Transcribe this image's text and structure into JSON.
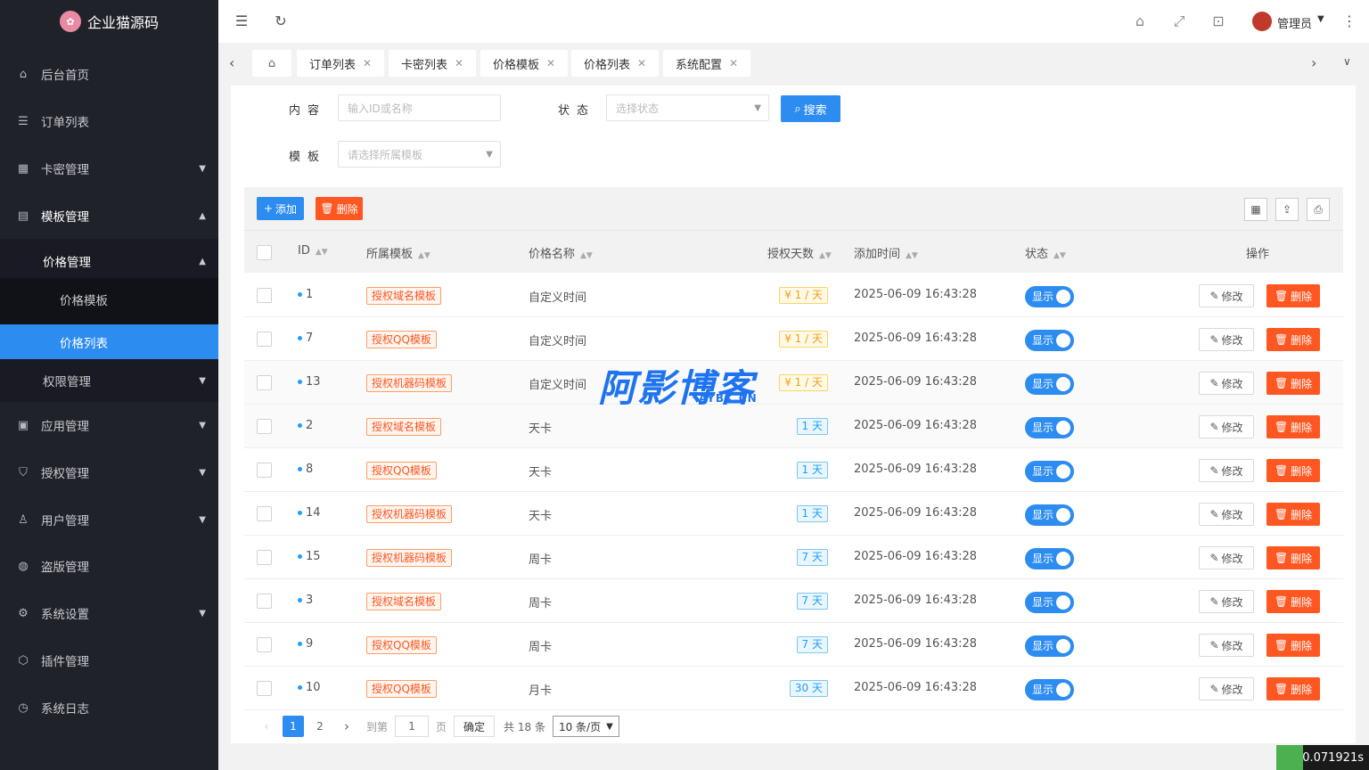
{
  "app": {
    "title": "企业猫源码",
    "logo_text": "企业猫"
  },
  "sidebar": {
    "items": [
      {
        "label": "后台首页",
        "icon": "home-icon"
      },
      {
        "label": "订单列表",
        "icon": "list-icon"
      },
      {
        "label": "卡密管理",
        "icon": "grid-icon"
      },
      {
        "label": "模板管理",
        "icon": "template-icon"
      },
      {
        "label": "价格管理"
      },
      {
        "label": "价格模板"
      },
      {
        "label": "价格列表"
      },
      {
        "label": "权限管理"
      },
      {
        "label": "应用管理",
        "icon": "apps-icon"
      },
      {
        "label": "授权管理",
        "icon": "shield-icon"
      },
      {
        "label": "用户管理",
        "icon": "user-icon"
      },
      {
        "label": "盗版管理",
        "icon": "globe-icon"
      },
      {
        "label": "系统设置",
        "icon": "gear-icon"
      },
      {
        "label": "插件管理",
        "icon": "cube-icon"
      },
      {
        "label": "系统日志",
        "icon": "clock-icon"
      }
    ]
  },
  "topbar": {
    "user": "管理员"
  },
  "tabs": [
    {
      "label": "订单列表"
    },
    {
      "label": "卡密列表"
    },
    {
      "label": "价格模板"
    },
    {
      "label": "价格列表"
    },
    {
      "label": "系统配置"
    }
  ],
  "filters": {
    "content_label": "内容",
    "content_placeholder": "输入ID或名称",
    "status_label": "状态",
    "status_placeholder": "选择状态",
    "search_label": "搜索",
    "template_label": "模板",
    "template_placeholder": "请选择所属模板"
  },
  "toolbar": {
    "add_label": "添加",
    "delete_label": "删除"
  },
  "table": {
    "headers": {
      "id": "ID",
      "template": "所属模板",
      "name": "价格名称",
      "days": "授权天数",
      "time": "添加时间",
      "status": "状态",
      "actions": "操作"
    },
    "edit_label": "修改",
    "delete_label": "删除",
    "rows": [
      {
        "id": "1",
        "template": "授权域名模板",
        "name": "自定义时间",
        "days": "¥ 1 / 天",
        "days_type": "price",
        "time": "2025-06-09 16:43:28",
        "status": "显示"
      },
      {
        "id": "7",
        "template": "授权QQ模板",
        "name": "自定义时间",
        "days": "¥ 1 / 天",
        "days_type": "price",
        "time": "2025-06-09 16:43:28",
        "status": "显示"
      },
      {
        "id": "13",
        "template": "授权机器码模板",
        "name": "自定义时间",
        "days": "¥ 1 / 天",
        "days_type": "price",
        "time": "2025-06-09 16:43:28",
        "status": "显示"
      },
      {
        "id": "2",
        "template": "授权域名模板",
        "name": "天卡",
        "days": "1 天",
        "days_type": "day",
        "time": "2025-06-09 16:43:28",
        "status": "显示"
      },
      {
        "id": "8",
        "template": "授权QQ模板",
        "name": "天卡",
        "days": "1 天",
        "days_type": "day",
        "time": "2025-06-09 16:43:28",
        "status": "显示"
      },
      {
        "id": "14",
        "template": "授权机器码模板",
        "name": "天卡",
        "days": "1 天",
        "days_type": "day",
        "time": "2025-06-09 16:43:28",
        "status": "显示"
      },
      {
        "id": "15",
        "template": "授权机器码模板",
        "name": "周卡",
        "days": "7 天",
        "days_type": "day",
        "time": "2025-06-09 16:43:28",
        "status": "显示"
      },
      {
        "id": "3",
        "template": "授权域名模板",
        "name": "周卡",
        "days": "7 天",
        "days_type": "day",
        "time": "2025-06-09 16:43:28",
        "status": "显示"
      },
      {
        "id": "9",
        "template": "授权QQ模板",
        "name": "周卡",
        "days": "7 天",
        "days_type": "day",
        "time": "2025-06-09 16:43:28",
        "status": "显示"
      },
      {
        "id": "10",
        "template": "授权QQ模板",
        "name": "月卡",
        "days": "30 天",
        "days_type": "day",
        "time": "2025-06-09 16:43:28",
        "status": "显示"
      }
    ]
  },
  "pagination": {
    "pages": [
      "1",
      "2"
    ],
    "goto_label": "到第",
    "goto_value": "1",
    "page_label": "页",
    "confirm": "确定",
    "total": "共 18 条",
    "per_page": "10 条/页"
  },
  "watermark": {
    "text": "阿影博客",
    "sub": "AYBK.CN"
  },
  "timer": "0.071921s",
  "colors": {
    "primary": "#2d8cf0",
    "danger": "#ff5722",
    "sidebar": "#20222a"
  }
}
